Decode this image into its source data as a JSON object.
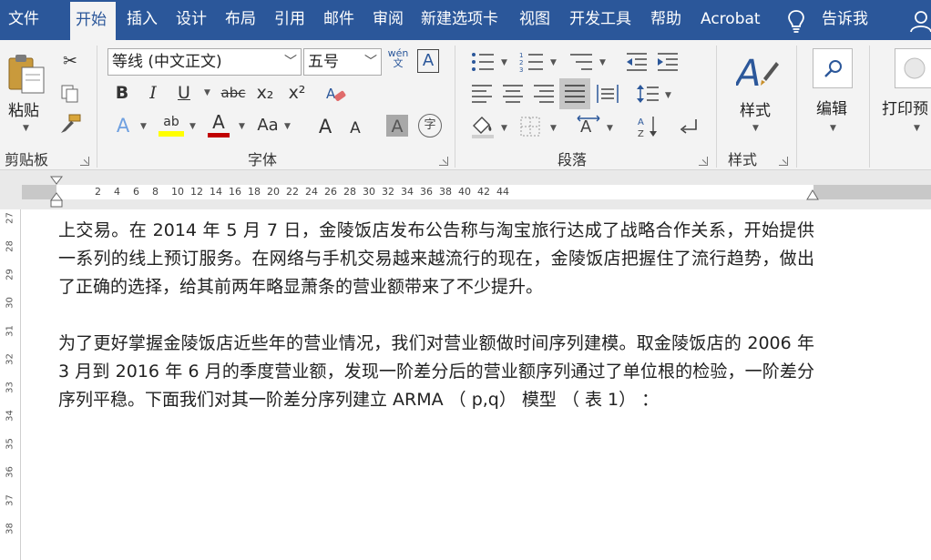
{
  "tabs": [
    {
      "label": "文件",
      "active": false
    },
    {
      "label": "开始",
      "active": true
    },
    {
      "label": "插入",
      "active": false
    },
    {
      "label": "设计",
      "active": false
    },
    {
      "label": "布局",
      "active": false
    },
    {
      "label": "引用",
      "active": false
    },
    {
      "label": "邮件",
      "active": false
    },
    {
      "label": "审阅",
      "active": false
    },
    {
      "label": "新建选项卡",
      "active": false
    },
    {
      "label": "视图",
      "active": false
    },
    {
      "label": "开发工具",
      "active": false
    },
    {
      "label": "帮助",
      "active": false
    },
    {
      "label": "Acrobat",
      "active": false
    }
  ],
  "tell_me": "告诉我",
  "groups": {
    "clipboard": {
      "label": "剪贴板",
      "paste": "粘贴"
    },
    "font": {
      "label": "字体",
      "font_name": "等线 (中文正文)",
      "font_size": "五号",
      "phonetic": "wén\n文",
      "border_char": "A"
    },
    "paragraph": {
      "label": "段落"
    },
    "styles": {
      "label": "样式",
      "styles_button": "样式"
    },
    "editing": {
      "label": "编辑"
    },
    "print": {
      "label": "打印预"
    }
  },
  "font_buttons": {
    "bold": "B",
    "italic": "I",
    "underline": "U",
    "strike": "abc",
    "sub": "x₂",
    "sup": "x²",
    "text_effect": "A",
    "highlight": "ab",
    "font_color": "A",
    "case": "Aa",
    "grow": "A",
    "shrink": "A",
    "shade": "A",
    "enclose": "字"
  },
  "ruler": {
    "ticks": [
      "2",
      "4",
      "6",
      "8",
      "10",
      "12",
      "14",
      "16",
      "18",
      "20",
      "22",
      "24",
      "26",
      "28",
      "30",
      "32",
      "34",
      "36",
      "38",
      "40",
      "42",
      "44"
    ]
  },
  "vruler": {
    "ticks": [
      "27",
      "28",
      "29",
      "30",
      "31",
      "32",
      "33",
      "34",
      "35",
      "36",
      "37",
      "38"
    ]
  },
  "document": {
    "para1": "上交易。在 2014 年 5 月 7 日，金陵饭店发布公告称与淘宝旅行达成了战略合作关系，开始提供一系列的线上预订服务。在网络与手机交易越来越流行的现在，金陵饭店把握住了流行趋势，做出了正确的选择，给其前两年略显萧条的营业额带来了不少提升。",
    "para2": "为了更好掌握金陵饭店近些年的营业情况，我们对营业额做时间序列建模。取金陵饭店的 2006 年 3 月到 2016 年 6 月的季度营业额，发现一阶差分后的营业额序列通过了单位根的检验，一阶差分序列平稳。下面我们对其一阶差分序列建立 ARMA （ p,q） 模型 （ 表 1） ："
  }
}
